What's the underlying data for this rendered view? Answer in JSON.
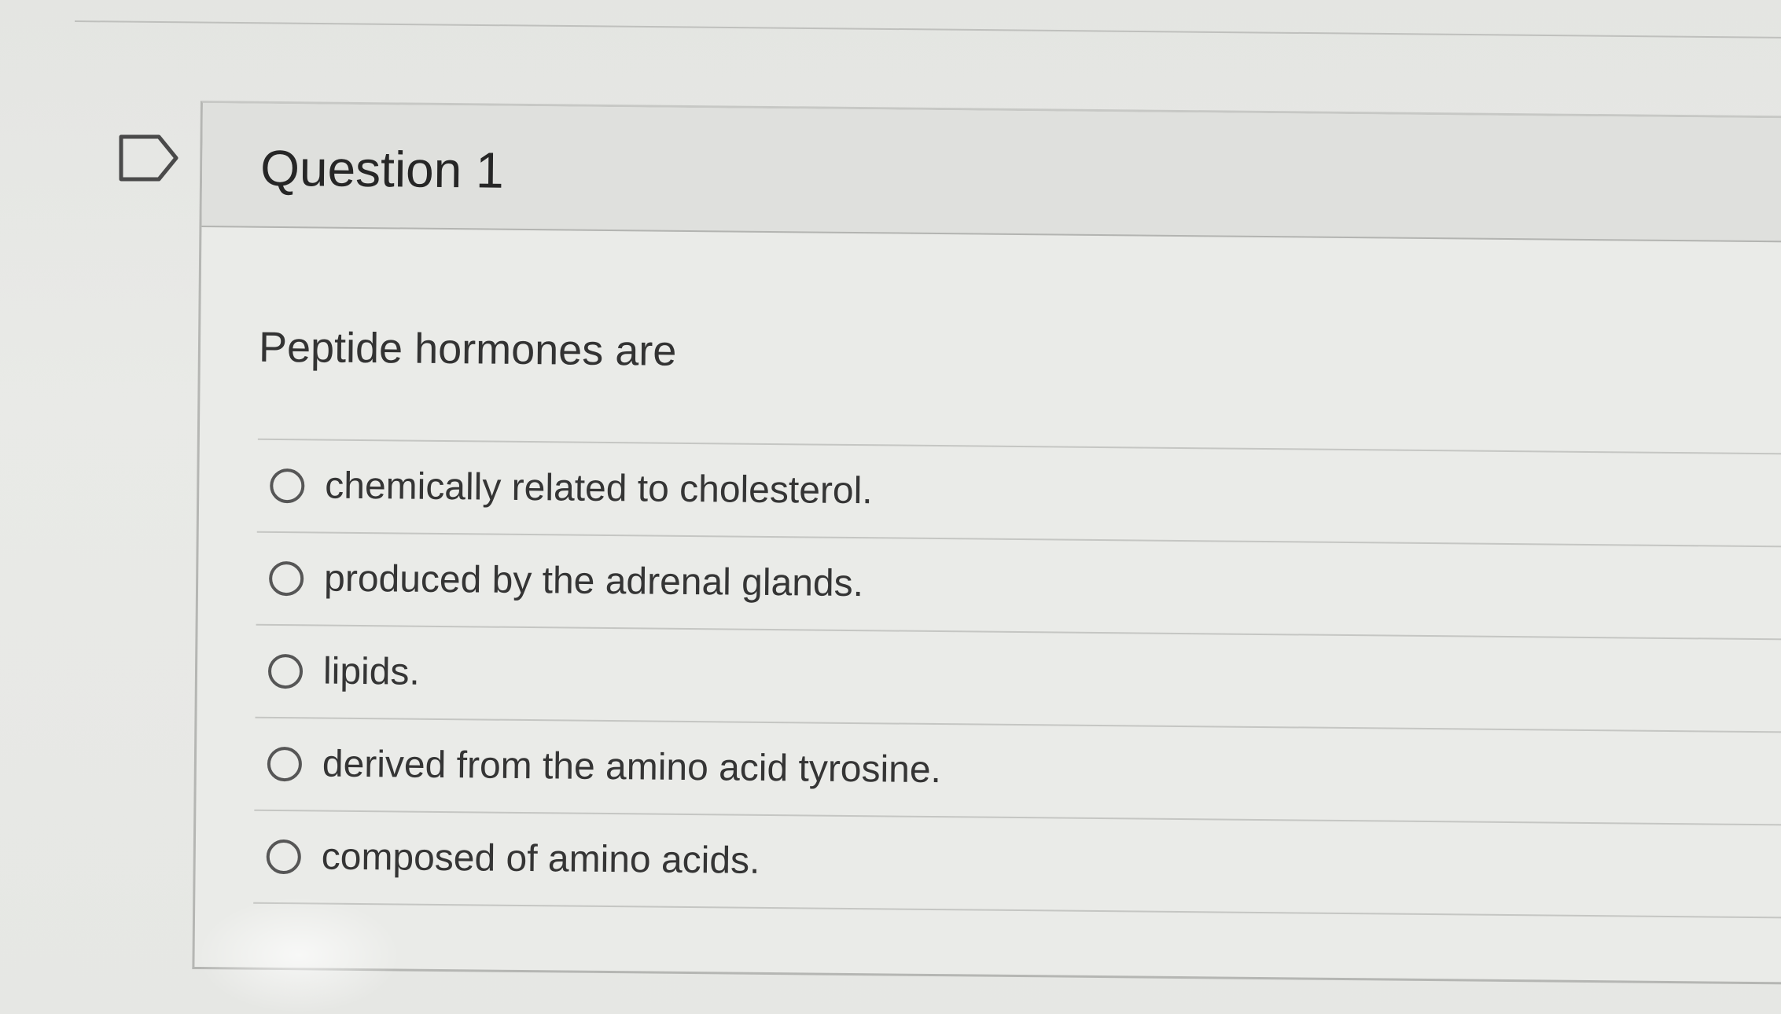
{
  "question": {
    "title": "Question 1",
    "prompt": "Peptide hormones are",
    "answers": [
      {
        "label": "chemically related to cholesterol."
      },
      {
        "label": "produced by the adrenal glands."
      },
      {
        "label": "lipids."
      },
      {
        "label": "derived from the amino acid tyrosine."
      },
      {
        "label": "composed of amino acids."
      }
    ]
  },
  "icons": {
    "flag": "flag-question-icon"
  },
  "colors": {
    "background": "#e9eae7",
    "header_background": "#dfe0dd",
    "text": "#2d2d2d",
    "radio_border": "#565656",
    "divider": "#c5c6c3"
  }
}
